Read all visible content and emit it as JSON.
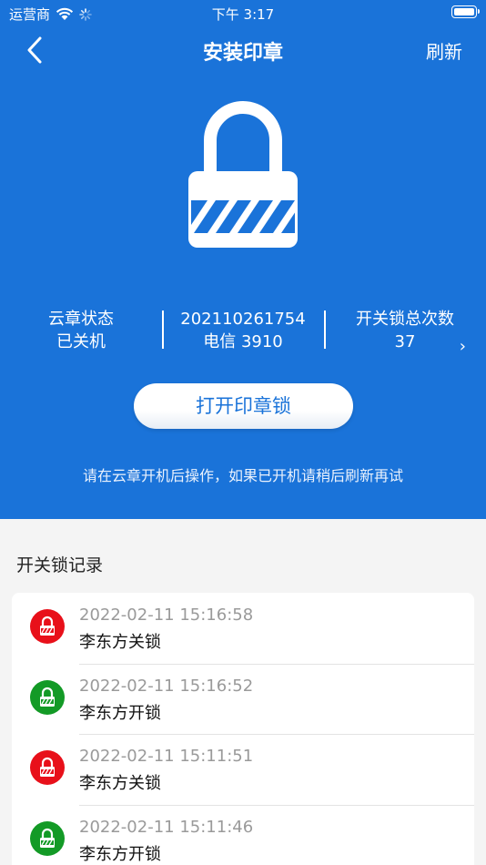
{
  "status_bar": {
    "carrier": "运营商",
    "time": "下午 3:17"
  },
  "nav": {
    "title": "安装印章",
    "refresh_label": "刷新"
  },
  "stats": [
    {
      "label": "云章状态",
      "value": "已关机"
    },
    {
      "label": "202110261754",
      "value": "电信 3910"
    },
    {
      "label": "开关锁总次数",
      "value": "37"
    }
  ],
  "open_button_label": "打开印章锁",
  "hint": "请在云章开机后操作，如果已开机请稍后刷新再试",
  "records_title": "开关锁记录",
  "records": [
    {
      "time": "2022-02-11 15:16:58",
      "text": "李东方关锁",
      "status": "closed"
    },
    {
      "time": "2022-02-11 15:16:52",
      "text": "李东方开锁",
      "status": "open"
    },
    {
      "time": "2022-02-11 15:11:51",
      "text": "李东方关锁",
      "status": "closed"
    },
    {
      "time": "2022-02-11 15:11:46",
      "text": "李东方开锁",
      "status": "open"
    }
  ],
  "colors": {
    "primary": "#1a73d9",
    "closed": "#e8101a",
    "open": "#139a26"
  }
}
